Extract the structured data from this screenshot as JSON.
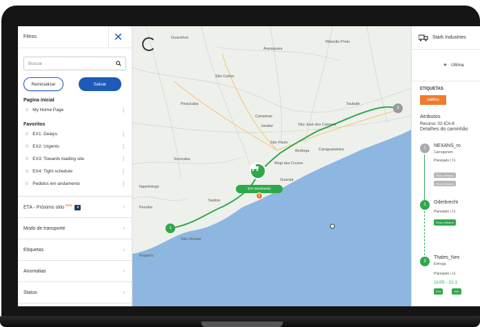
{
  "sidebar": {
    "title": "Filtros",
    "search_placeholder": "Buscar",
    "reset_label": "Reinicializar",
    "save_label": "Salvar",
    "home_section": "Pagina inicial",
    "home_item": "My Home Page",
    "favorites_section": "Favoritos",
    "favorites": [
      "EX1: Delays",
      "EX2: Urgents",
      "EX3: Towards loading site",
      "EX4: Tight schedule",
      "Pedidos em andamento"
    ],
    "accordions": {
      "eta": "ETA - Próximo sitio",
      "eta_badge": "Beta",
      "eta_count": "4",
      "transport": "Modo de transporte",
      "tags": "Etiquetas",
      "anomalies": "Anomalias",
      "status": "Status"
    }
  },
  "map": {
    "labels": [
      "Guarulhos",
      "São Carlos",
      "Campinas",
      "Jundiaí",
      "São Paulo",
      "Mogi das Cruzes",
      "São José dos Campos",
      "Caraguatatuba",
      "Santos",
      "Guarujá",
      "São Vicente",
      "Peruíbe",
      "Registro",
      "Piracicaba",
      "Sorocaba",
      "Itapetininga",
      "Araraquara",
      "Ribeirão Preto",
      "Taubaté",
      "Bertioga"
    ],
    "pill_label": "Em movimento",
    "start_number": "1",
    "end_number": "3",
    "orange_number": "2",
    "colors": {
      "route": "#2ea84b",
      "sea": "#8db7e0",
      "land": "#eef0ec"
    }
  },
  "right": {
    "company": "Stark Industries",
    "sub_label": "Última",
    "tags_title": "ETIQUETAS",
    "tag": "cables",
    "attrs_title": "Atributos",
    "recurso_line": "Recurso: 02-ICA-8",
    "detalhes_line": "Detalhes do caminhão",
    "stops": [
      {
        "n": "1",
        "name": "NEXANS_ro",
        "sub": "Carregamen",
        "plan": "Planejado | 11",
        "chips": [
          "Fluxo_Nexans",
          "Fluxo_Nexans"
        ]
      },
      {
        "n": "2",
        "name": "Oderbrecht",
        "sub": "",
        "plan": "Planejado | 11",
        "chips": [
          "Fluxo_Nexans"
        ]
      },
      {
        "n": "3",
        "name": "Thales_Nex",
        "sub": "Entrega",
        "plan": "Planejado | 11",
        "time": "11/05 - 21:1",
        "chips": [
          "ETA",
          "11/0"
        ]
      }
    ]
  }
}
